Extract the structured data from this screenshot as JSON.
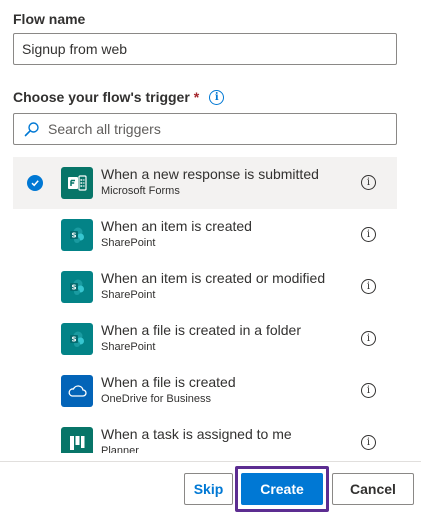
{
  "flow_name": {
    "label": "Flow name",
    "value": "Signup from web"
  },
  "trigger": {
    "label": "Choose your flow's trigger",
    "required_mark": "*",
    "info_glyph": "i",
    "search_placeholder": "Search all triggers"
  },
  "triggers": [
    {
      "title": "When a new response is submitted",
      "app": "Microsoft Forms",
      "icon": "forms-icon",
      "selected": true
    },
    {
      "title": "When an item is created",
      "app": "SharePoint",
      "icon": "sharepoint-icon",
      "selected": false
    },
    {
      "title": "When an item is created or modified",
      "app": "SharePoint",
      "icon": "sharepoint-icon",
      "selected": false
    },
    {
      "title": "When a file is created in a folder",
      "app": "SharePoint",
      "icon": "sharepoint-icon",
      "selected": false
    },
    {
      "title": "When a file is created",
      "app": "OneDrive for Business",
      "icon": "onedrive-icon",
      "selected": false
    },
    {
      "title": "When a task is assigned to me",
      "app": "Planner",
      "icon": "planner-icon",
      "selected": false
    }
  ],
  "buttons": {
    "skip": "Skip",
    "create": "Create",
    "cancel": "Cancel"
  },
  "colors": {
    "accent": "#0078d4",
    "forms": "#077568",
    "sharepoint": "#038387",
    "onedrive": "#0364b8",
    "planner": "#077568",
    "highlight": "#5c2d91"
  }
}
